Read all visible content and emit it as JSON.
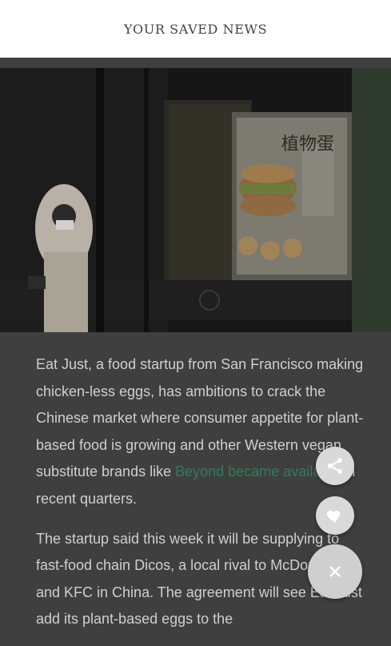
{
  "header": {
    "title": "YOUR SAVED NEWS"
  },
  "hero": {
    "sign_text": "植物蛋",
    "alt": "Person wearing mask near plant-based egg advertisement"
  },
  "article": {
    "p1_before": "Eat Just, a food startup from San Francisco making chicken-less eggs, has ambitions to crack the Chinese market where consumer appetite for plant-based food is growing and other Western vegan substitute brands like ",
    "p1_link": "Beyond became available",
    "p1_after": " in recent quarters.",
    "p2": "The startup said this week it will be supplying to fast-food chain Dicos, a local rival to McDonald’s and KFC in China. The agreement will see Eat Just add its plant-based eggs to the"
  },
  "actions": {
    "share_icon": "share-icon",
    "like_icon": "heart-icon",
    "close_icon": "close-icon"
  },
  "colors": {
    "overlay_bg": "#3f3f3f",
    "link": "#2e7d5b",
    "fab": "#d9d9d9"
  }
}
